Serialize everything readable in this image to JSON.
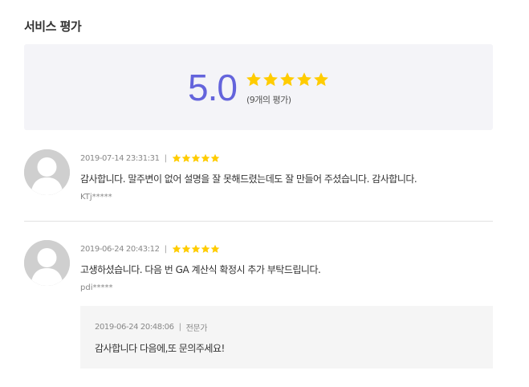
{
  "section_title": "서비스 평가",
  "summary": {
    "score": "5.0",
    "rating": 5,
    "rating_count": "(9개의 평가)",
    "star_color": "#ffcc00",
    "score_color": "#6464dc"
  },
  "reviews": [
    {
      "date": "2019-07-14 23:31:31",
      "separator": "|",
      "rating": 5,
      "text": "감사합니다. 말주변이 없어 설명을 잘 못해드렸는데도 잘 만들어 주셨습니다. 감사합니다.",
      "author": "KTj*****"
    },
    {
      "date": "2019-06-24 20:43:12",
      "separator": "|",
      "rating": 5,
      "text": "고생하셨습니다. 다음 번 GA 계산식 확정시 추가 부탁드립니다.",
      "author": "pdi*****",
      "reply": {
        "date": "2019-06-24 20:48:06",
        "separator": "|",
        "role": "전문가",
        "text": "감사합니다 다음에,또 문의주세요!"
      }
    }
  ]
}
